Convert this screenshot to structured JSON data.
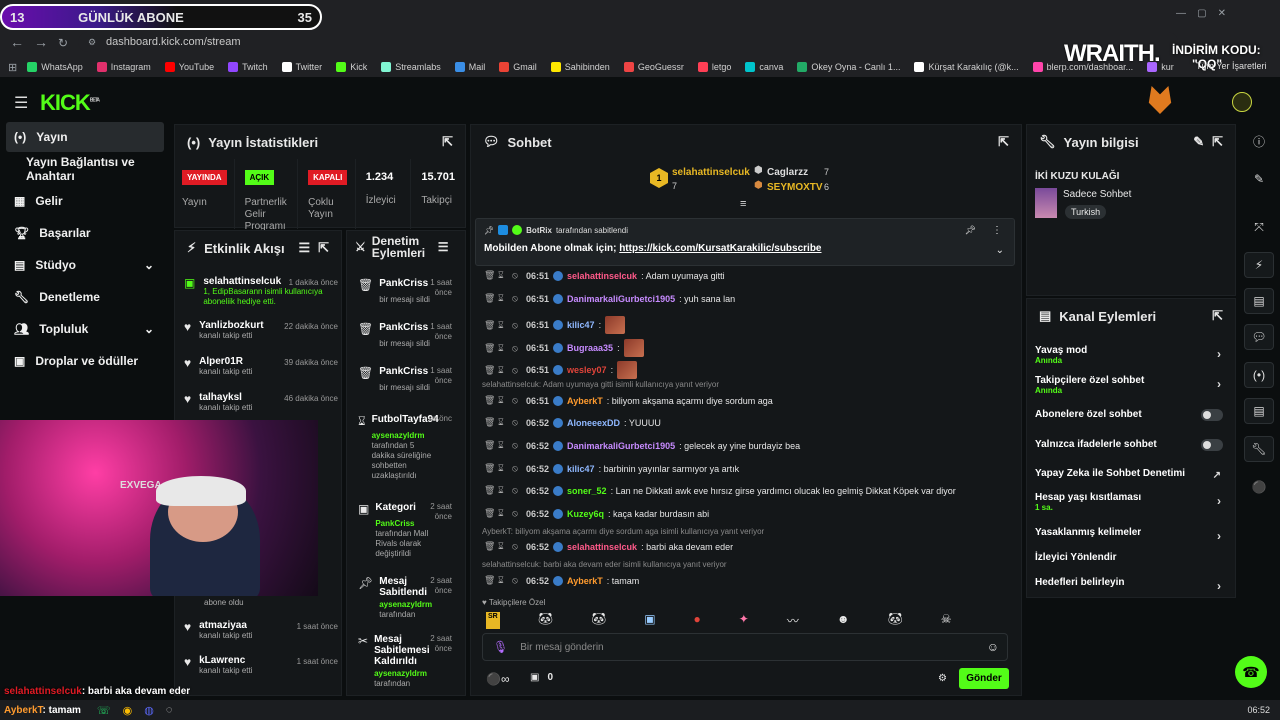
{
  "osd": {
    "left_num": "13",
    "title": "GÜNLÜK ABONE",
    "right_num": "35"
  },
  "browser": {
    "url": "dashboard.kick.com/stream"
  },
  "bookmarks": [
    {
      "label": "WhatsApp",
      "color": "#25d366"
    },
    {
      "label": "Instagram",
      "color": "#e1306c"
    },
    {
      "label": "YouTube",
      "color": "#ff0000"
    },
    {
      "label": "Twitch",
      "color": "#9146ff"
    },
    {
      "label": "Twitter",
      "color": "#ffffff"
    },
    {
      "label": "Kick",
      "color": "#53fc18"
    },
    {
      "label": "Streamlabs",
      "color": "#80f5d2"
    },
    {
      "label": "Mail",
      "color": "#3a8ee6"
    },
    {
      "label": "Gmail",
      "color": "#ea4335"
    },
    {
      "label": "Sahibinden",
      "color": "#ffe800"
    },
    {
      "label": "GeoGuessr",
      "color": "#e44"
    },
    {
      "label": "letgo",
      "color": "#ff3f55"
    },
    {
      "label": "canva",
      "color": "#00c4cc"
    },
    {
      "label": "Okey Oyna - Canlı 1...",
      "color": "#2a6"
    },
    {
      "label": "Kürşat Karakılıç (@k...",
      "color": "#fff"
    },
    {
      "label": "blerp.com/dashboar...",
      "color": "#f4a"
    },
    {
      "label": "kur",
      "color": "#a6f"
    }
  ],
  "bookmarks_right": "Tüm Yer İşaretleri",
  "promo": {
    "brand": "WRAITH.",
    "code_label": "İNDİRİM KODU:",
    "code": "\"QQ\""
  },
  "kick": {
    "logo": "KICK",
    "beta": "BETA"
  },
  "sidebar": {
    "items": [
      {
        "label": "Yayın"
      },
      {
        "label": "Yayın Bağlantısı ve Anahtarı"
      },
      {
        "label": "Gelir"
      },
      {
        "label": "Başarılar"
      },
      {
        "label": "Stüdyo"
      },
      {
        "label": "Denetleme"
      },
      {
        "label": "Topluluk"
      },
      {
        "label": "Droplar ve ödüller"
      }
    ]
  },
  "stats": {
    "title": "Yayın İstatistikleri",
    "cells": [
      {
        "badge": "YAYINDA",
        "badge_color": "#e01b24",
        "label": "Yayın"
      },
      {
        "badge": "AÇIK",
        "badge_color": "#53fc18",
        "label": "Partnerlik Gelir Programı"
      },
      {
        "badge": "KAPALI",
        "badge_color": "#e01b24",
        "label": "Çoklu Yayın"
      },
      {
        "value": "1.234",
        "label": "İzleyici"
      },
      {
        "value": "15.701",
        "label": "Takipçi"
      }
    ]
  },
  "activity": {
    "title": "Etkinlik Akışı",
    "items": [
      {
        "name": "selahattinselcuk",
        "time": "1 dakika önce",
        "sub": "1, EdipBasarann isimli kullanıcıya aboneliik hediye etti."
      },
      {
        "name": "Yanlizbozkurt",
        "time": "22 dakika önce",
        "sub": "kanalı takip etti"
      },
      {
        "name": "Alper01R",
        "time": "39 dakika önce",
        "sub": "kanalı takip etti"
      },
      {
        "name": "talhayksl",
        "time": "46 dakika önce",
        "sub": "kanalı takip etti"
      },
      {
        "name": "atmaziyaa",
        "time": "1 saat önce",
        "sub": "kanalı takip etti"
      },
      {
        "name": "kLawrenc",
        "time": "1 saat önce",
        "sub": "kanalı takip etti"
      }
    ],
    "partial_sub": "abone oldu"
  },
  "moderation": {
    "title": "Denetim Eylemleri",
    "items": [
      {
        "name": "PankCriss",
        "time": "1 saat önce",
        "sub": "bir mesajı sildi"
      },
      {
        "name": "PankCriss",
        "time": "1 saat önce",
        "sub": "bir mesajı sildi"
      },
      {
        "name": "PankCriss",
        "time": "1 saat önce",
        "sub": "bir mesajı sildi"
      },
      {
        "name": "FutbolTayfa94",
        "time": "sa önc",
        "sub_user": "aysenazyldrm",
        "sub": "tarafından 5 dakika süreliğine sohbetten uzaklaştırıldı"
      },
      {
        "name": "Kategori",
        "time": "2 saat önce",
        "sub_user": "PankCriss",
        "sub": "tarafından Mall Rivals olarak değiştirildi"
      },
      {
        "name": "Mesaj Sabitlendi",
        "time": "2 saat önce",
        "sub_user": "aysenazyldrm",
        "sub": "tarafından"
      },
      {
        "name": "Mesaj Sabitlemesi Kaldırıldı",
        "time": "2 saat önce",
        "sub_user": "aysenazyldrm",
        "sub": "tarafından"
      }
    ]
  },
  "chat": {
    "title": "Sohbet",
    "top": [
      {
        "name": "selahattinselcuk",
        "count": "7"
      },
      {
        "name": "Caglarzz",
        "count": "7"
      },
      {
        "name": "SEYMOXTV",
        "count": "6"
      }
    ],
    "pinned": {
      "by": "BotRix",
      "by_suffix": "tarafından sabitlendi",
      "text": "Mobilden Abone olmak için; ",
      "link": "https://kick.com/KursatKarakilic/subscribe"
    },
    "messages": [
      {
        "time": "06:51",
        "user": "selahattinselcuk",
        "color": "#ff5a8a",
        "text": ": Adam uyumaya gitti"
      },
      {
        "time": "06:51",
        "user": "DanimarkaliGurbetci1905",
        "color": "#c78bff",
        "text": ": yuh sana lan"
      },
      {
        "time": "06:51",
        "user": "kilic47",
        "color": "#8fb8ff",
        "text": ":"
      },
      {
        "time": "06:51",
        "user": "Bugraaa35",
        "color": "#c78bff",
        "text": ":"
      },
      {
        "time": "06:51",
        "user": "wesley07",
        "color": "#e0443a",
        "text": ":"
      },
      {
        "time": "06:51",
        "user": "AyberkT",
        "color": "#ff9b2e",
        "text": ": biliyom akşama açarmı diye sordum aga"
      },
      {
        "time": "06:52",
        "user": "AloneeexDD",
        "color": "#8fb8ff",
        "text": ": YUUUU"
      },
      {
        "time": "06:52",
        "user": "DanimarkaliGurbetci1905",
        "color": "#c78bff",
        "text": ": gelecek ay yine burdayiz bea"
      },
      {
        "time": "06:52",
        "user": "kilic47",
        "color": "#8fb8ff",
        "text": ": barbinin yayınlar sarmıyor ya artık"
      },
      {
        "time": "06:52",
        "user": "soner_52",
        "color": "#53fc18",
        "text": ": Lan ne Dikkati awk eve hırsız girse yardımcı olucak leo gelmiş Dikkat Köpek var diyor"
      },
      {
        "time": "06:52",
        "user": "Kuzey6q",
        "color": "#53fc18",
        "text": ": kaça kadar burdasın abi"
      },
      {
        "time": "06:52",
        "user": "selahattinselcuk",
        "color": "#ff5a8a",
        "text": ": barbi aka devam eder"
      },
      {
        "time": "06:52",
        "user": "AyberkT",
        "color": "#ff9b2e",
        "text": ": tamam"
      }
    ],
    "replies": [
      "selahattinselcuk: Adam uyumaya gitti isimli kullanıcıya yanıt veriyor",
      "AyberkT: biliyom akşama açarmı diye sordum aga isimli kullanıcıya yanıt veriyor",
      "selahattinselcuk: barbi aka devam eder isimli kullanıcıya yanıt veriyor"
    ],
    "followers_only": "Takipçilere Özel",
    "input_placeholder": "Bir mesaj gönderin",
    "points": "0",
    "send_label": "Gönder"
  },
  "stream_info": {
    "title": "Yayın bilgisi",
    "stream_title": "İKİ KUZU KULAĞI",
    "category": "Sadece Sohbet",
    "language": "Turkish"
  },
  "channel_actions": {
    "title": "Kanal Eylemleri",
    "items": [
      {
        "label": "Yavaş mod",
        "sub": "Anında",
        "kind": "chevron"
      },
      {
        "label": "Takipçilere özel sohbet",
        "sub": "Anında",
        "kind": "chevron"
      },
      {
        "label": "Abonelere özel sohbet",
        "sub": "",
        "kind": "toggle"
      },
      {
        "label": "Yalnızca ifadelerle sohbet",
        "sub": "",
        "kind": "toggle"
      },
      {
        "label": "Yapay Zeka ile Sohbet Denetimi",
        "sub": "",
        "kind": "external"
      },
      {
        "label": "Hesap yaşı kısıtlaması",
        "sub": "1 sa.",
        "kind": "chevron"
      },
      {
        "label": "Yasaklanmış kelimeler",
        "sub": "",
        "kind": "chevron"
      },
      {
        "label": "İzleyici Yönlendir",
        "sub": "",
        "kind": "none"
      },
      {
        "label": "Hedefleri belirleyin",
        "sub": "",
        "kind": "chevron"
      }
    ]
  },
  "overlay_chat": [
    {
      "user": "selahattinselcuk",
      "text": ": barbi aka devam eder"
    },
    {
      "user": "AyberkT",
      "text": ": tamam"
    }
  ],
  "cam_text": "EXVEGA",
  "taskbar": {
    "time": "06:52"
  }
}
